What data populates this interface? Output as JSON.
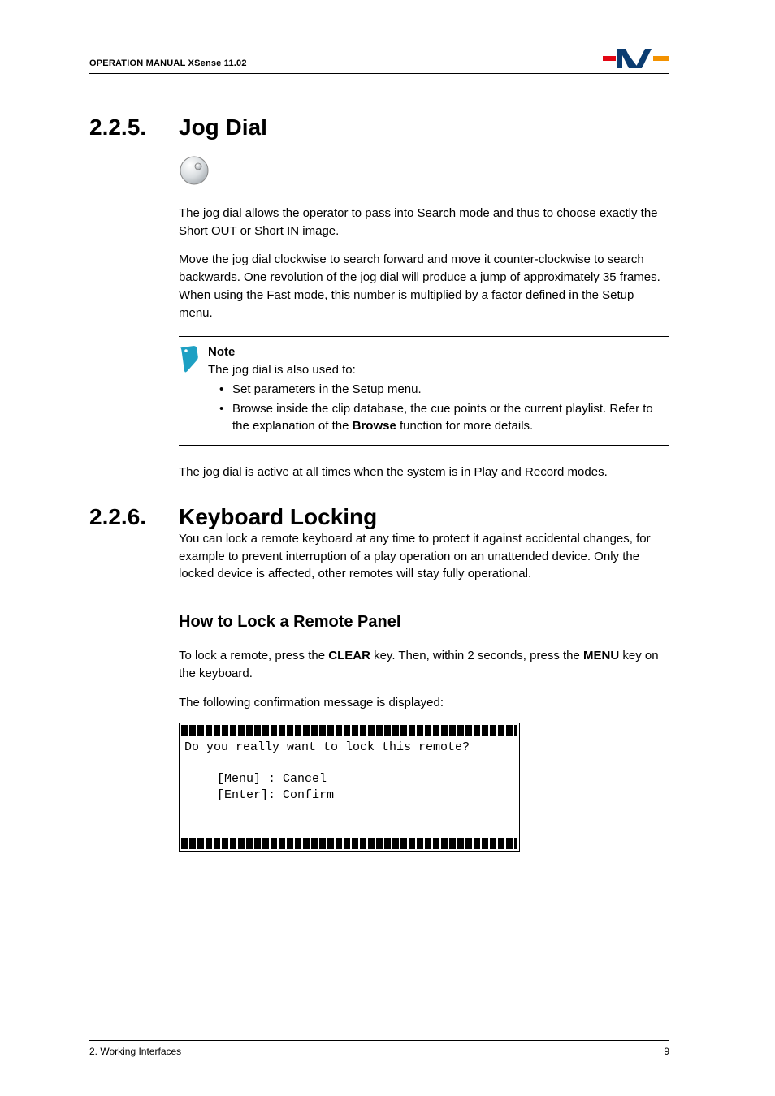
{
  "header": {
    "left": "OPERATION MANUAL  XSense 11.02"
  },
  "sections": {
    "s225": {
      "num": "2.2.5.",
      "title": "Jog Dial",
      "p1": "The jog dial allows the operator to pass into Search mode and thus to choose exactly the Short OUT or Short IN image.",
      "p2": "Move the jog dial clockwise to search forward and move it counter-clockwise to search backwards. One revolution of the jog dial will produce a jump of approximately 35 frames. When using the Fast mode, this number is multiplied by a factor defined in the Setup menu.",
      "note": {
        "label": "Note",
        "intro": "The jog dial is also used to:",
        "items": [
          "Set parameters in the Setup menu.",
          "Browse inside the clip database, the cue points or the current playlist. Refer to the explanation of the Browse function for more details."
        ],
        "browse_word": "Browse"
      },
      "p3": "The jog dial is active at all times when the system is in Play and Record modes."
    },
    "s226": {
      "num": "2.2.6.",
      "title": "Keyboard Locking",
      "p1": "You can lock a remote keyboard at any time to protect it against accidental changes, for example to prevent interruption of a play operation on an unattended device. Only the locked device is affected, other remotes will stay fully operational.",
      "subhead": "How to Lock a Remote Panel",
      "p2_pre": "To lock a remote, press the ",
      "p2_key1": "CLEAR",
      "p2_mid": " key. Then, within 2 seconds, press the ",
      "p2_key2": "MENU",
      "p2_post": " key on the keyboard.",
      "p3": "The following confirmation message is displayed:",
      "code": {
        "q": "Do you really want to lock this remote?",
        "opt1": "[Menu] : Cancel",
        "opt2": "[Enter]: Confirm"
      }
    }
  },
  "footer": {
    "left": "2. Working Interfaces",
    "right": "9"
  }
}
